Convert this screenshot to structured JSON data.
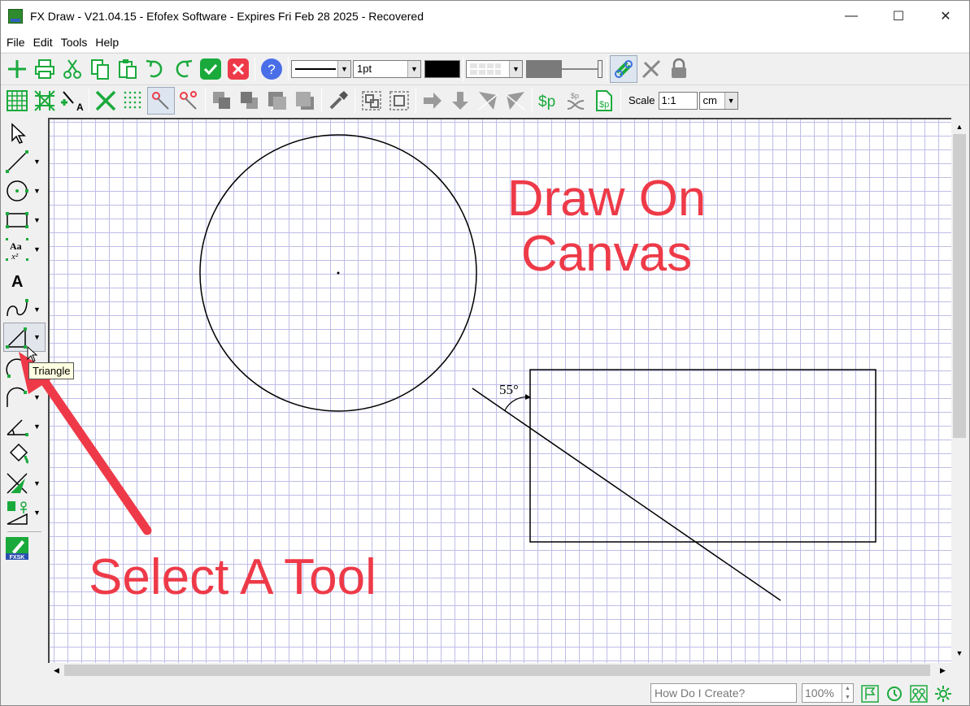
{
  "window": {
    "title": "FX Draw - V21.04.15 - Efofex Software - Expires Fri Feb 28 2025 - Recovered",
    "controls": {
      "minimize": "—",
      "maximize": "☐",
      "close": "✕"
    }
  },
  "menu": [
    "File",
    "Edit",
    "Tools",
    "Help"
  ],
  "toolbar_top": {
    "icons": [
      "new-icon",
      "print-icon",
      "cut-icon",
      "copy-icon",
      "paste-icon",
      "undo-icon",
      "redo-icon",
      "ok-icon",
      "cancel-icon",
      "help-icon"
    ],
    "line_width": "1pt",
    "right_icons": [
      "link-icon",
      "unlink-icon",
      "lock-icon"
    ]
  },
  "toolbar_second": {
    "icons": [
      "grid-icon",
      "snap-grid-icon",
      "snap-label-icon",
      "delete-icon",
      "dot-grid-icon",
      "point-select-icon",
      "point-link-icon",
      "arrange-icon",
      "group-icon",
      "eyedropper-icon",
      "align-icon",
      "distribute-icon",
      "move-icon",
      "flip-icon",
      "dollar-p-icon",
      "shuffle-icon",
      "doc-icon"
    ],
    "scale_label": "Scale",
    "scale_value": "1:1",
    "unit": "cm"
  },
  "palette": {
    "tools": [
      "pointer-icon",
      "line-icon",
      "circle-icon",
      "rectangle-icon",
      "label-icon",
      "text-icon",
      "curve-icon",
      "triangle-icon",
      "arc-icon",
      "path-icon",
      "angle-icon",
      "fill-icon",
      "intersect-icon",
      "shapes-icon",
      "fxsk-icon"
    ],
    "tooltip": "Triangle",
    "fxsk_label": "FXSK"
  },
  "canvas": {
    "angle_label": "55°",
    "annotation_tool": "Select A Tool",
    "annotation_canvas_line1": "Draw On",
    "annotation_canvas_line2": "Canvas"
  },
  "statusbar": {
    "help_placeholder": "How Do I Create?",
    "zoom": "100%"
  },
  "colors": {
    "annotation": "#ee3a48",
    "grid": "#bdbde8",
    "accent_green": "#1aaa3c"
  }
}
